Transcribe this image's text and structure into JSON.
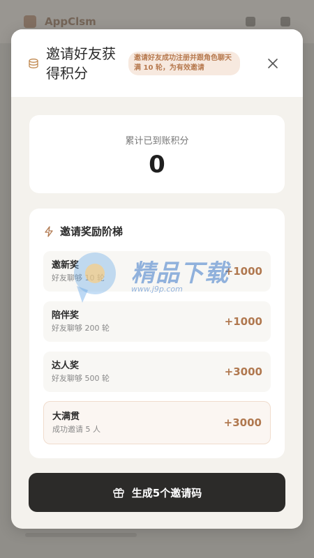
{
  "background": {
    "app_title": "AppClsm"
  },
  "modal": {
    "title": "邀请好友获得积分",
    "badge": "邀请好友成功注册并跟角色聊天满 10 轮，为有效邀请",
    "points": {
      "label": "累计已到账积分",
      "value": "0"
    },
    "ladder": {
      "title": "邀请奖励阶梯",
      "tiers": [
        {
          "name": "邀新奖",
          "desc": "好友聊够 10 轮",
          "points": "+1000"
        },
        {
          "name": "陪伴奖",
          "desc": "好友聊够 200 轮",
          "points": "+1000"
        },
        {
          "name": "达人奖",
          "desc": "好友聊够 500 轮",
          "points": "+3000"
        },
        {
          "name": "大满贯",
          "desc": "成功邀请 5 人",
          "points": "+3000"
        }
      ]
    },
    "generate_button": "生成5个邀请码"
  },
  "watermark": {
    "text": "精品下载",
    "url": "www.j9p.com"
  },
  "colors": {
    "accent": "#b0784f",
    "badge_bg": "#f7e9df",
    "button_bg": "#2c2b29"
  },
  "icons": {
    "header": "coin-stack-icon",
    "close": "close-icon",
    "ladder": "lightning-icon",
    "button": "gift-icon"
  }
}
